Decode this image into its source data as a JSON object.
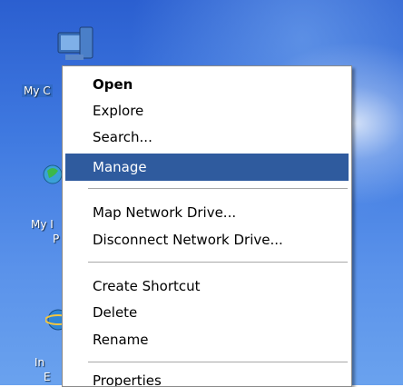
{
  "desktop": {
    "icons": [
      {
        "name": "my-computer",
        "label": "My C"
      },
      {
        "name": "my-network-places",
        "label_line1": "My I",
        "label_line2": "P"
      },
      {
        "name": "internet-explorer",
        "label_line1": "In",
        "label_line2": "E"
      }
    ]
  },
  "context_menu": {
    "items": [
      {
        "label": "Open",
        "bold": true,
        "highlighted": false
      },
      {
        "label": "Explore",
        "bold": false,
        "highlighted": false
      },
      {
        "label": "Search...",
        "bold": false,
        "highlighted": false
      },
      {
        "label": "Manage",
        "bold": false,
        "highlighted": true
      },
      {
        "label": "Map Network Drive...",
        "bold": false,
        "highlighted": false
      },
      {
        "label": "Disconnect Network Drive...",
        "bold": false,
        "highlighted": false
      },
      {
        "label": "Create Shortcut",
        "bold": false,
        "highlighted": false
      },
      {
        "label": "Delete",
        "bold": false,
        "highlighted": false
      },
      {
        "label": "Rename",
        "bold": false,
        "highlighted": false
      },
      {
        "label": "Properties",
        "bold": false,
        "highlighted": false
      }
    ]
  },
  "colors": {
    "highlight": "#2f5b9e",
    "desktop_blue": "#3f79e0"
  }
}
